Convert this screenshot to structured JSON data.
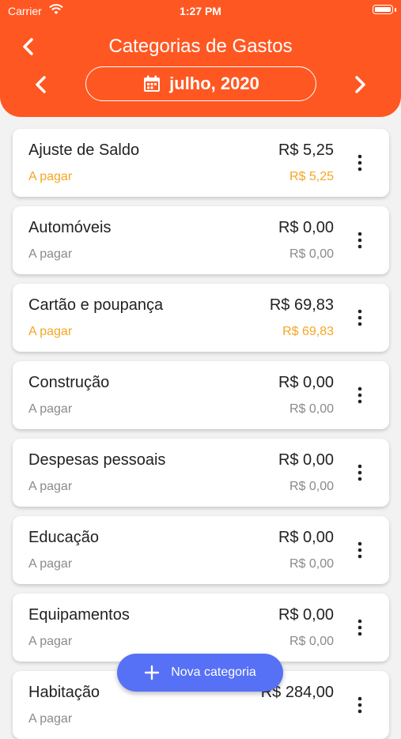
{
  "status_bar": {
    "carrier": "Carrier",
    "time": "1:27 PM"
  },
  "header": {
    "title": "Categorias de Gastos",
    "month": "julho, 2020"
  },
  "colors": {
    "accent": "#ff5722",
    "pending": "#f5a623",
    "fab": "#5671f5"
  },
  "categories": [
    {
      "name": "Ajuste de Saldo",
      "amount": "R$ 5,25",
      "status": "A pagar",
      "due": "R$ 5,25",
      "pending": true
    },
    {
      "name": "Automóveis",
      "amount": "R$ 0,00",
      "status": "A pagar",
      "due": "R$ 0,00",
      "pending": false
    },
    {
      "name": "Cartão e poupança",
      "amount": "R$ 69,83",
      "status": "A pagar",
      "due": "R$ 69,83",
      "pending": true
    },
    {
      "name": "Construção",
      "amount": "R$ 0,00",
      "status": "A pagar",
      "due": "R$ 0,00",
      "pending": false
    },
    {
      "name": "Despesas pessoais",
      "amount": "R$ 0,00",
      "status": "A pagar",
      "due": "R$ 0,00",
      "pending": false
    },
    {
      "name": "Educação",
      "amount": "R$ 0,00",
      "status": "A pagar",
      "due": "R$ 0,00",
      "pending": false
    },
    {
      "name": "Equipamentos",
      "amount": "R$ 0,00",
      "status": "A pagar",
      "due": "R$ 0,00",
      "pending": false
    },
    {
      "name": "Habitação",
      "amount": "R$ 284,00",
      "status": "A pagar",
      "due": "",
      "pending": false
    }
  ],
  "fab": {
    "label": "Nova categoria",
    "icon": "plus-icon"
  }
}
